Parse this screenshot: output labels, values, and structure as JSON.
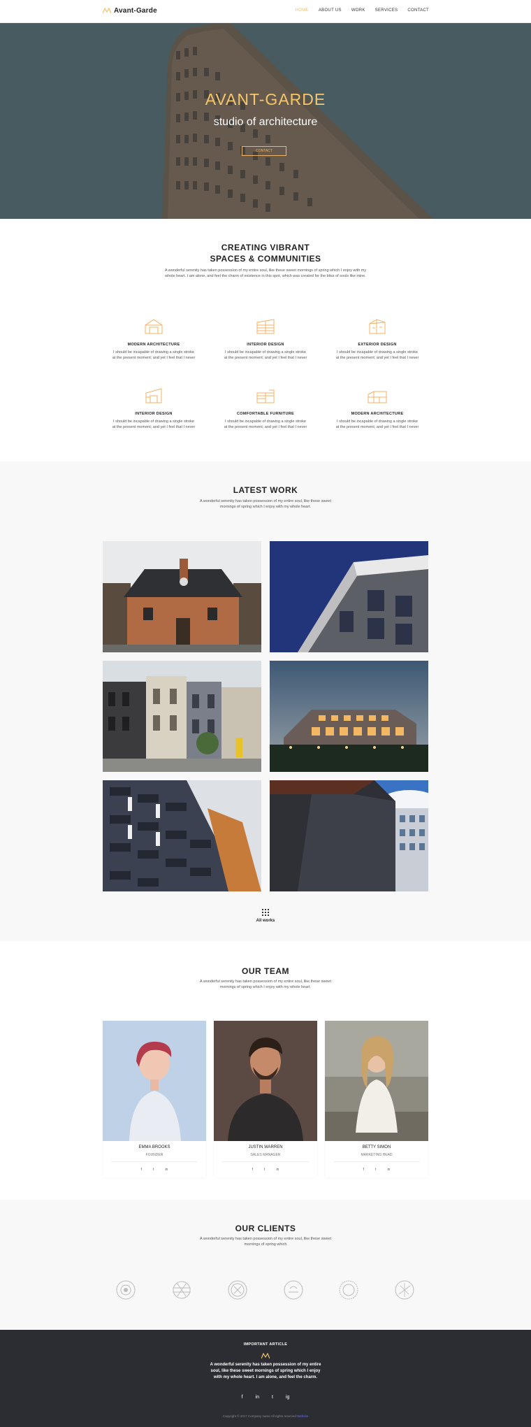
{
  "nav": {
    "logo": "Avant-Garde",
    "items": [
      {
        "label": "HOME",
        "active": true
      },
      {
        "label": "ABOUT US",
        "active": false
      },
      {
        "label": "WORK",
        "active": false
      },
      {
        "label": "SERVICES",
        "active": false
      },
      {
        "label": "CONTACT",
        "active": false
      }
    ]
  },
  "hero": {
    "title": "AVANT-GARDE",
    "subtitle": "studio of architecture",
    "button": "Contact"
  },
  "services": {
    "title_line1": "CREATING VIBRANT",
    "title_line2": "SPACES & COMMUNITIES",
    "text": "A wonderful serenity has taken possession of my entire soul, like these sweet mornings of spring which I enjoy with my whole heart. I am alone, and feel the charm of existence in this spot, which was created for the bliss of souls like mine.",
    "items": [
      {
        "title": "MODERN ARCHITECTURE",
        "text": "I should be incapable of drawing a single stroke at the present moment; and yet I feel that I never",
        "icon": "house-icon"
      },
      {
        "title": "INTERIOR DESIGN",
        "text": "I should be incapable of drawing a single stroke at the present moment; and yet I feel that I never",
        "icon": "building-icon"
      },
      {
        "title": "EXTERIOR DESIGN",
        "text": "I should be incapable of drawing a single stroke at the present moment; and yet I feel that I never",
        "icon": "cube-building-icon"
      },
      {
        "title": "INTERIOR DESIGN",
        "text": "I should be incapable of drawing a single stroke at the present moment; and yet I feel that I never",
        "icon": "interior-icon"
      },
      {
        "title": "COMFORTABLE FURNITURE",
        "text": "I should be incapable of drawing a single stroke at the present moment; and yet I feel that I never",
        "icon": "furniture-icon"
      },
      {
        "title": "MODERN ARCHITECTURE",
        "text": "I should be incapable of drawing a single stroke at the present moment; and yet I feel that I never",
        "icon": "modern-building-icon"
      }
    ]
  },
  "work": {
    "title": "LATEST WORK",
    "text": "A wonderful serenity has taken possession of my entire soul, like these sweet mornings of spring which I enjoy with my whole heart.",
    "all_works": "All works"
  },
  "team": {
    "title": "OUR TEAM",
    "text": "A wonderful serenity has taken possession of my entire soul, like these sweet mornings of spring which I enjoy with my whole heart.",
    "members": [
      {
        "name": "EMMA BROOKS",
        "role": "FOUNDER"
      },
      {
        "name": "JUSTIN WARREN",
        "role": "SALES MANAGER"
      },
      {
        "name": "BETTY SIMON",
        "role": "MARKETING HEAD"
      }
    ],
    "social": [
      "f",
      "t",
      "in"
    ]
  },
  "clients": {
    "title": "OUR CLIENTS",
    "text": "A wonderful serenity has taken possession of my entire soul, like these sweet mornings of spring which"
  },
  "footer": {
    "title": "IMPORTANT ARTICLE",
    "text": "A wonderful serenity has taken possession of my entire soul, like these sweet mornings of spring which I enjoy with my whole heart. I am alone, and feel the charm.",
    "social": [
      "f",
      "in",
      "t",
      "ig"
    ],
    "copyright": "Copyright © 2017 Company name All rights reserved",
    "copyright_link": "Website"
  },
  "colors": {
    "accent": "#f5c064",
    "dark": "#2c2d33"
  }
}
